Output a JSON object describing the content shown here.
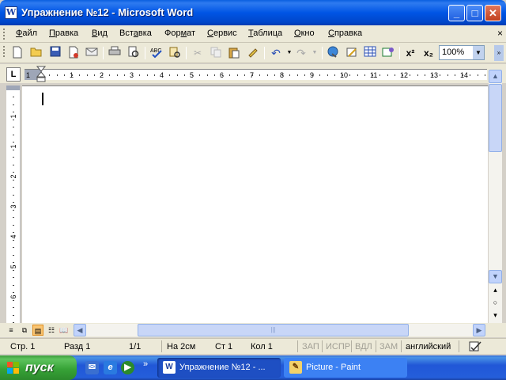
{
  "window": {
    "title": "Упражнение №12 - Microsoft Word",
    "icon_letter": "W",
    "minimize_glyph": "_",
    "maximize_glyph": "□",
    "close_glyph": "✕"
  },
  "menu": {
    "items": [
      {
        "pre": "",
        "u": "Ф",
        "post": "айл"
      },
      {
        "pre": "",
        "u": "П",
        "post": "равка"
      },
      {
        "pre": "",
        "u": "В",
        "post": "ид"
      },
      {
        "pre": "Вст",
        "u": "а",
        "post": "вка"
      },
      {
        "pre": "Фор",
        "u": "м",
        "post": "ат"
      },
      {
        "pre": "",
        "u": "С",
        "post": "ервис"
      },
      {
        "pre": "",
        "u": "Т",
        "post": "аблица"
      },
      {
        "pre": "",
        "u": "О",
        "post": "кно"
      },
      {
        "pre": "",
        "u": "С",
        "post": "правка"
      }
    ],
    "close_glyph": "×"
  },
  "toolbar": {
    "zoom": "100%",
    "zoom_arrow": "▼",
    "superscript": "x²",
    "subscript": "x₂",
    "icons": [
      "new-icon",
      "open-icon",
      "save-icon",
      "permission-icon",
      "email-icon",
      "print-icon",
      "print-preview-icon",
      "spelling-icon",
      "research-icon",
      "cut-icon",
      "copy-icon",
      "paste-icon",
      "format-painter-icon",
      "undo-icon",
      "redo-icon",
      "hyperlink-icon",
      "tables-borders-icon",
      "insert-table-icon",
      "insert-excel-icon"
    ],
    "end_glyph": "»"
  },
  "ruler": {
    "tab_selector": "L",
    "numbers": [
      "1",
      "1",
      "2",
      "3",
      "4",
      "5",
      "6",
      "7",
      "8",
      "9",
      "10",
      "11",
      "12",
      "13",
      "14"
    ],
    "vertical_numbers": [
      "1",
      "1",
      "2",
      "3",
      "4",
      "5",
      "6",
      "7"
    ]
  },
  "scroll": {
    "up": "▲",
    "down": "▼",
    "prev_page": "▴",
    "select_object": "○",
    "next_page": "▾",
    "left": "◀",
    "right": "▶"
  },
  "status": {
    "page": "Стр. 1",
    "section": "Разд 1",
    "pages": "1/1",
    "at": "На 2см",
    "line": "Ст 1",
    "col": "Кол 1",
    "rec": "ЗАП",
    "trk": "ИСПР",
    "ext": "ВДЛ",
    "ovr": "ЗАМ",
    "language": "английский"
  },
  "taskbar": {
    "start_label": "пуск",
    "quick_more": "»",
    "tasks": [
      {
        "label": "Упражнение №12 - ...",
        "active": true,
        "icon": "W"
      },
      {
        "label": "Picture - Paint",
        "active": false,
        "icon": "✎"
      }
    ]
  },
  "colors": {
    "titlebar": "#0055e5",
    "start_green": "#37a337",
    "taskbar_blue": "#245edb"
  }
}
